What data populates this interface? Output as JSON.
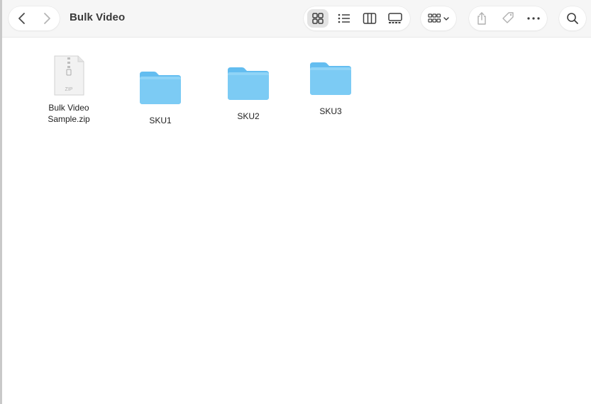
{
  "window": {
    "title": "Bulk Video"
  },
  "toolbar": {
    "back_icon": "chevron-left-icon",
    "forward_icon": "chevron-right-icon",
    "views": [
      {
        "name": "icon-view",
        "selected": true
      },
      {
        "name": "list-view",
        "selected": false
      },
      {
        "name": "column-view",
        "selected": false
      },
      {
        "name": "gallery-view",
        "selected": false
      }
    ],
    "group_icon": "group-by-icon",
    "share_icon": "share-icon",
    "tag_icon": "tag-icon",
    "more_icon": "ellipsis-icon",
    "search_icon": "search-icon"
  },
  "files": [
    {
      "name": "Bulk Video\nSample.zip",
      "kind": "zip",
      "badge": "ZIP"
    },
    {
      "name": "SKU1",
      "kind": "folder"
    },
    {
      "name": "SKU2",
      "kind": "folder"
    },
    {
      "name": "SKU3",
      "kind": "folder"
    }
  ],
  "colors": {
    "folder_top": "#7dcaf3",
    "folder_body": "#5bb8ee",
    "accent_text": "#3a3a3a"
  }
}
